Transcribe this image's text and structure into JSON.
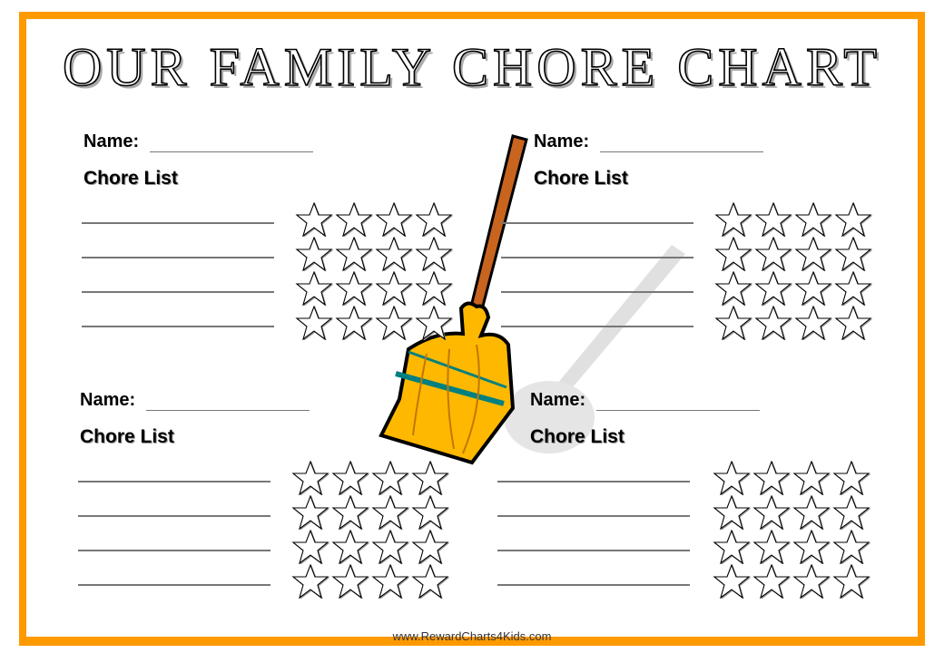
{
  "title": "OUR FAMILY CHORE CHART",
  "colors": {
    "border": "#ff9900",
    "broom_head": "#ffb800",
    "broom_band": "#008080",
    "handle": "#c8641e"
  },
  "panels": [
    {
      "name_label": "Name:",
      "chore_title": "Chore List",
      "chore_lines": 4,
      "stars_per_row": 4,
      "star_rows": 4
    },
    {
      "name_label": "Name:",
      "chore_title": "Chore List",
      "chore_lines": 4,
      "stars_per_row": 4,
      "star_rows": 4
    },
    {
      "name_label": "Name:",
      "chore_title": "Chore List",
      "chore_lines": 4,
      "stars_per_row": 4,
      "star_rows": 4
    },
    {
      "name_label": "Name:",
      "chore_title": "Chore List",
      "chore_lines": 4,
      "stars_per_row": 4,
      "star_rows": 4
    }
  ],
  "icons": {
    "star": "star-outline-icon",
    "broom": "broom-illustration"
  },
  "footer": "www.RewardCharts4Kids.com"
}
